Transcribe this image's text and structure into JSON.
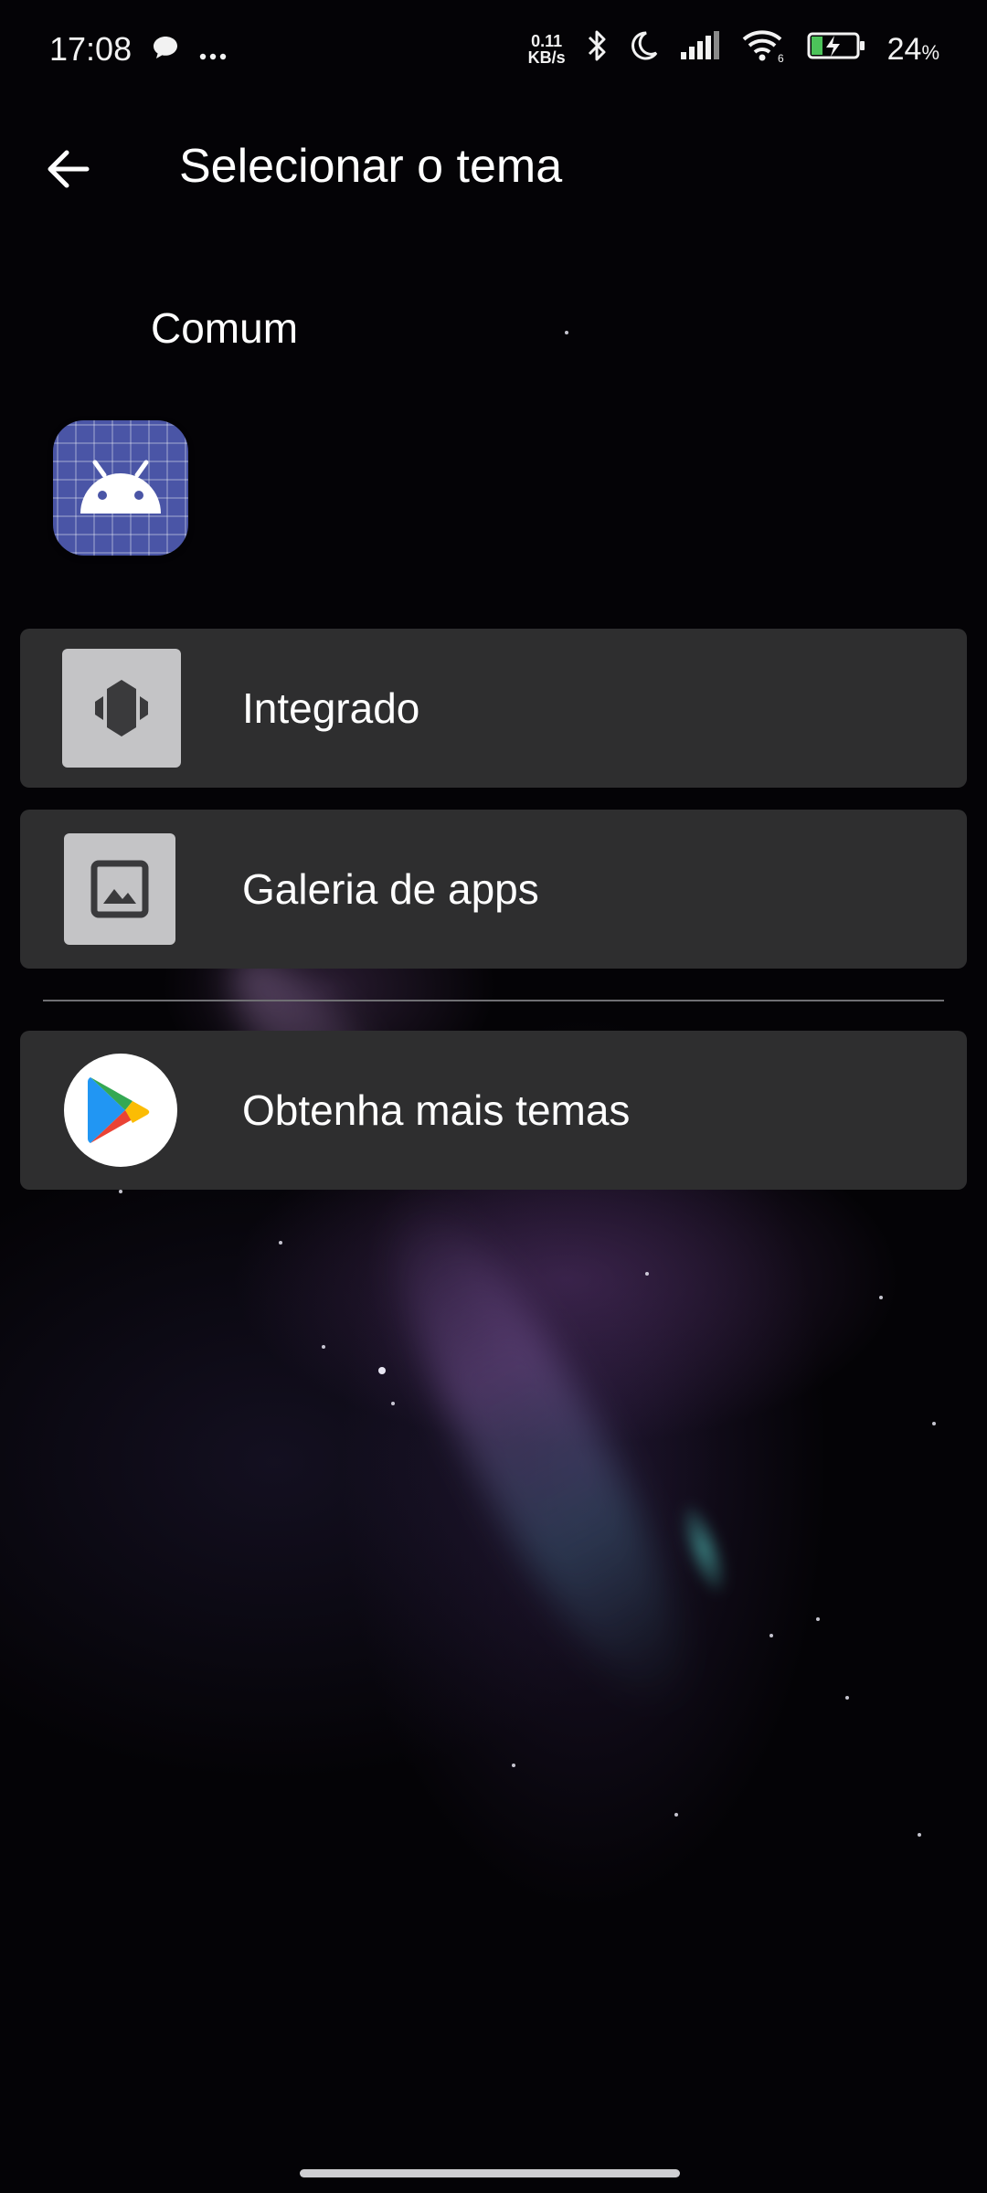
{
  "status_bar": {
    "time": "17:08",
    "net_speed_value": "0.11",
    "net_speed_unit": "KB/s",
    "battery": "24",
    "battery_unit": "%",
    "icons": [
      "chat-bubble-icon",
      "more-dots-icon",
      "bluetooth-icon",
      "do-not-disturb-moon-icon",
      "signal-bars-icon",
      "wifi-6-icon",
      "battery-charging-icon"
    ]
  },
  "app_bar": {
    "back_icon": "arrow-left-icon",
    "title": "Selecionar o tema"
  },
  "section": {
    "label": "Comum",
    "current_theme_icon": "android-robot-icon"
  },
  "options": [
    {
      "label": "Integrado",
      "icon": "integrated-theme-icon"
    },
    {
      "label": "Galeria de apps",
      "icon": "image-gallery-icon"
    },
    {
      "label": "Obtenha mais temas",
      "icon": "google-play-icon"
    }
  ],
  "colors": {
    "card_background": "#2e2e2f",
    "android_tile": "#4a55a6",
    "divider": "#6f6f73"
  }
}
